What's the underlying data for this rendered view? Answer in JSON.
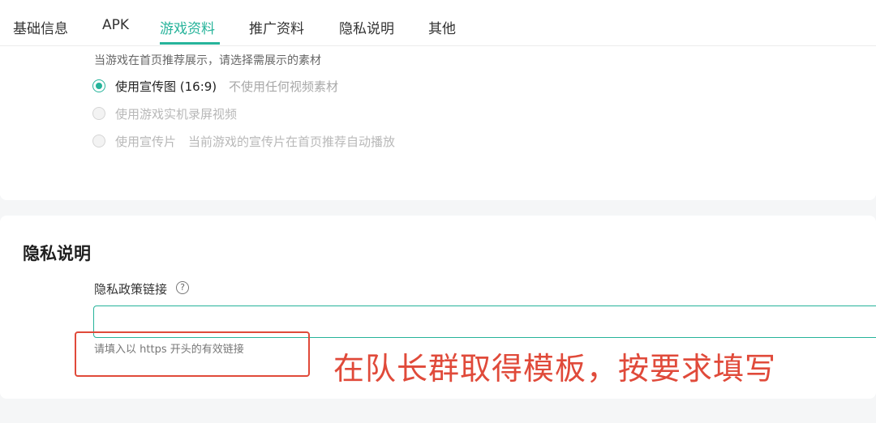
{
  "tabs": [
    {
      "label": "基础信息",
      "active": false
    },
    {
      "label": "APK",
      "active": false
    },
    {
      "label": "游戏资料",
      "active": true
    },
    {
      "label": "推广资料",
      "active": false
    },
    {
      "label": "隐私说明",
      "active": false
    },
    {
      "label": "其他",
      "active": false
    }
  ],
  "colors": {
    "accent": "#26b39a",
    "annotation": "#e04a3a"
  },
  "materials": {
    "hint": "当游戏在首页推荐展示，请选择需展示的素材",
    "options": [
      {
        "label": "使用宣传图 (16:9)",
        "sub": "不使用任何视频素材",
        "checked": true,
        "disabled": false
      },
      {
        "label": "使用游戏实机录屏视频",
        "sub": "",
        "checked": false,
        "disabled": true
      },
      {
        "label": "使用宣传片",
        "sub": "当前游戏的宣传片在首页推荐自动播放",
        "checked": false,
        "disabled": true
      }
    ]
  },
  "privacy": {
    "title": "隐私说明",
    "field_label": "隐私政策链接",
    "help_icon": "question-circle-icon",
    "help_glyph": "?",
    "input_value": "",
    "hint": "请填入以 https 开头的有效链接"
  },
  "annotation": {
    "text": "在队长群取得模板，按要求填写"
  }
}
